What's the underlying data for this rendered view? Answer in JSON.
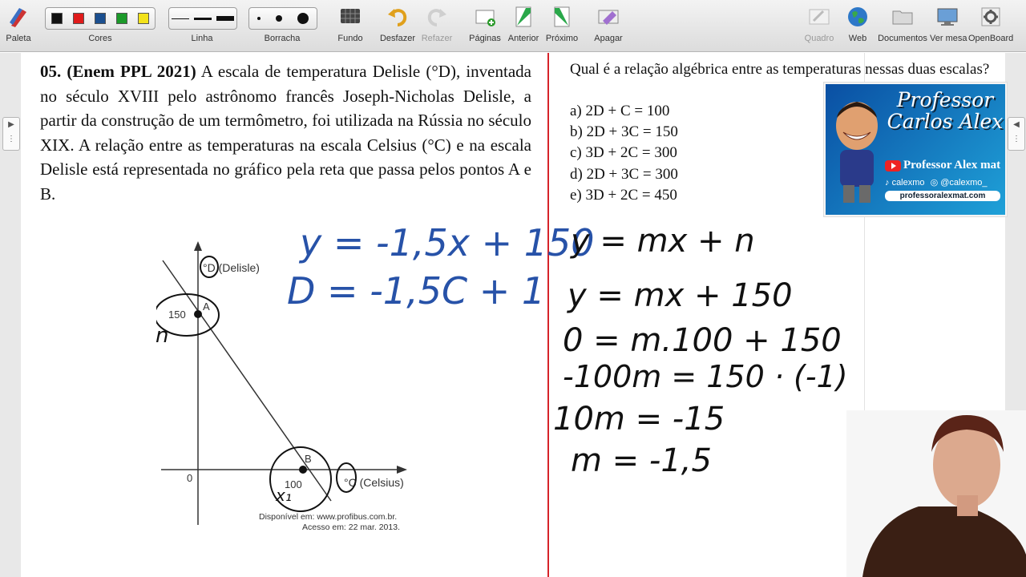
{
  "toolbar": {
    "paleta": "Paleta",
    "cores": "Cores",
    "linha": "Linha",
    "borracha": "Borracha",
    "fundo": "Fundo",
    "desfazer": "Desfazer",
    "refazer": "Refazer",
    "paginas": "Páginas",
    "anterior": "Anterior",
    "proximo": "Próximo",
    "apagar": "Apagar",
    "quadro": "Quadro",
    "web": "Web",
    "documentos": "Documentos",
    "ver_mesa": "Ver mesa",
    "openboard": "OpenBoard",
    "colors": [
      "#111111",
      "#e01b1b",
      "#1b4f8f",
      "#1c9a2a",
      "#f3e21a"
    ]
  },
  "question": {
    "number": "05. (Enem PPL 2021)",
    "text": " A escala de temperatura Delisle (°D), inventada no século XVIII pelo astrônomo francês Joseph-Nicholas Delisle, a partir da construção de um termômetro, foi utilizada na Rússia no século XIX. A relação entre as temperaturas na escala Celsius (°C) e na escala Delisle está representada no gráfico pela reta que passa pelos pontos A e B.",
    "prompt": "Qual é a relação algébrica entre as temperaturas nessas duas escalas?",
    "options": [
      "a) 2D + C = 100",
      "b) 2D + 3C = 150",
      "c) 3D + 2C = 300",
      "d) 2D + 3C = 300",
      "e) 3D + 2C = 450"
    ]
  },
  "graph": {
    "y_axis_label": "°D (Delisle)",
    "x_axis_label": "°C (Celsius)",
    "origin": "0",
    "point_a_label": "A",
    "point_a_value": "150",
    "point_b_label": "B",
    "point_b_value": "100",
    "source_line1": "Disponível em: www.profibus.com.br.",
    "source_line2": "Acesso em: 22 mar. 2013."
  },
  "handwriting": {
    "blue_line1": "y = -1,5x + 150",
    "blue_line2": "D = -1,5C + 1",
    "note_n": "n",
    "note_x1": "x₁",
    "black": [
      "y = mx + n",
      "y = mx + 150",
      "0 = m.100 + 150",
      "-100m = 150 · (-1)",
      "10m = -15",
      "m = -1,5"
    ]
  },
  "badge": {
    "title_line1": "Professor",
    "title_line2": "Carlos Alex",
    "youtube": "Professor Alex mat",
    "tiktok": "calexmo",
    "instagram": "@calexmo_",
    "url": "professoralexmat.com"
  }
}
